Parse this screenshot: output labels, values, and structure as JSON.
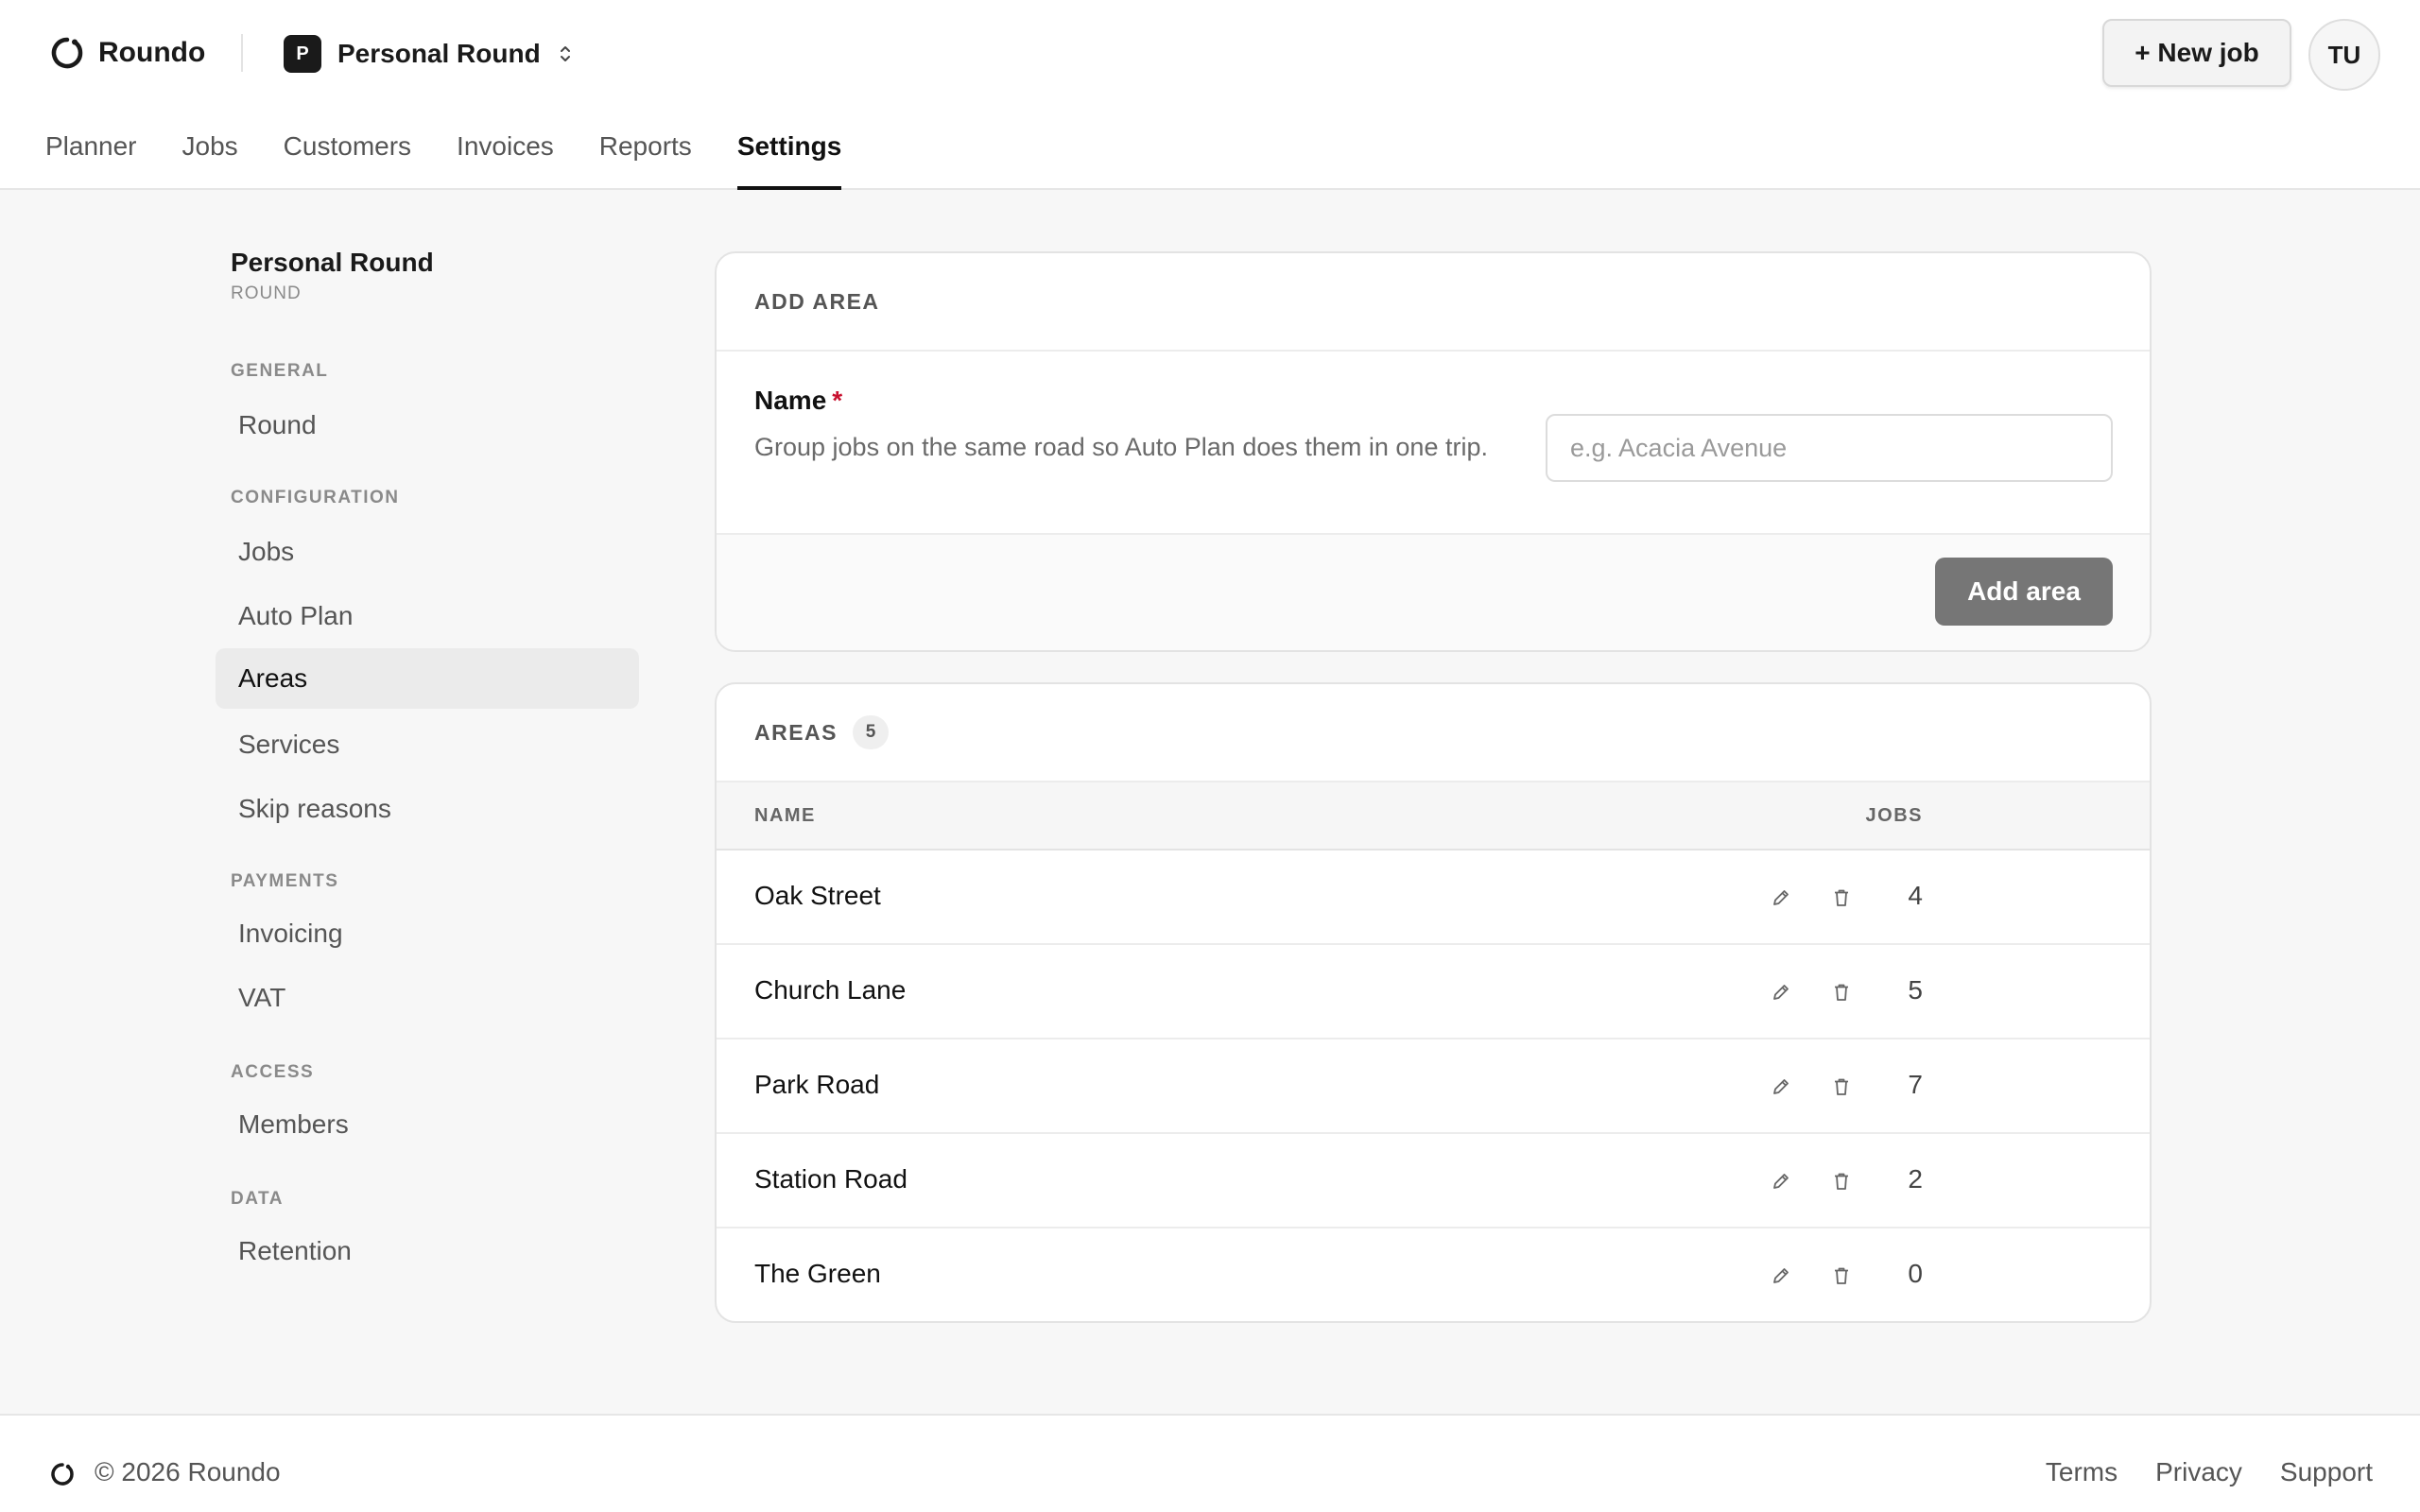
{
  "brand": {
    "name": "Roundo"
  },
  "round_switcher": {
    "initial": "P",
    "name": "Personal Round"
  },
  "header": {
    "new_job_label": "+ New job",
    "user_initials": "TU"
  },
  "tabs": [
    {
      "label": "Planner"
    },
    {
      "label": "Jobs"
    },
    {
      "label": "Customers"
    },
    {
      "label": "Invoices"
    },
    {
      "label": "Reports"
    },
    {
      "label": "Settings",
      "active": true
    }
  ],
  "sidebar": {
    "title": "Personal Round",
    "subtitle": "ROUND",
    "groups": {
      "general": "GENERAL",
      "configuration": "CONFIGURATION",
      "payments": "PAYMENTS",
      "access": "ACCESS",
      "data": "DATA"
    },
    "items": {
      "round": "Round",
      "jobs": "Jobs",
      "auto_plan": "Auto Plan",
      "areas": "Areas",
      "services": "Services",
      "skip_reasons": "Skip reasons",
      "invoicing": "Invoicing",
      "vat": "VAT",
      "members": "Members",
      "retention": "Retention"
    },
    "active_item": "Areas"
  },
  "add_area": {
    "title": "ADD AREA",
    "name_label": "Name",
    "required_mark": "*",
    "help": "Group jobs on the same road so Auto Plan does them in one trip.",
    "input_value": "",
    "input_placeholder": "e.g. Acacia Avenue",
    "button_label": "Add area"
  },
  "areas": {
    "title": "AREAS",
    "count": "5",
    "columns": {
      "name": "NAME",
      "jobs": "JOBS"
    },
    "rows": [
      {
        "name": "Oak Street",
        "jobs": "4"
      },
      {
        "name": "Church Lane",
        "jobs": "5"
      },
      {
        "name": "Park Road",
        "jobs": "7"
      },
      {
        "name": "Station Road",
        "jobs": "2"
      },
      {
        "name": "The Green",
        "jobs": "0"
      }
    ]
  },
  "footer": {
    "copyright": "© 2026 Roundo",
    "links": {
      "terms": "Terms",
      "privacy": "Privacy",
      "support": "Support"
    }
  },
  "icons": {
    "brand_logo": "ring-logo-icon",
    "switcher": "chevron-up-down-icon",
    "row_edit": "pencil-icon",
    "row_delete": "trash-icon"
  },
  "colors": {
    "active_underline": "#111111",
    "required": "#c8102e",
    "add_button": "#767676",
    "active_sidebar_bg": "#ebebeb"
  }
}
